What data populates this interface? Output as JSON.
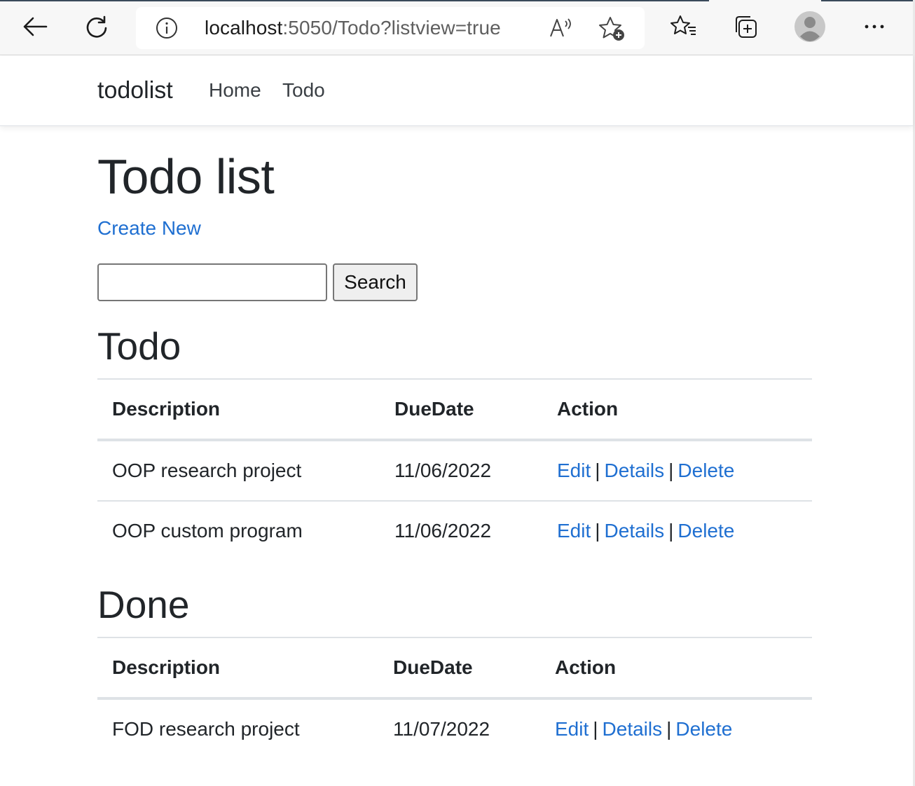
{
  "browser": {
    "url_host": "localhost",
    "url_rest": ":5050/Todo?listview=true"
  },
  "nav": {
    "brand": "todolist",
    "links": [
      "Home",
      "Todo"
    ]
  },
  "page": {
    "title": "Todo list",
    "create_label": "Create New",
    "search_value": "",
    "search_button": "Search"
  },
  "sections": [
    {
      "heading": "Todo",
      "columns": [
        "Description",
        "DueDate",
        "Action"
      ],
      "rows": [
        {
          "description": "OOP research project",
          "due": "11/06/2022"
        },
        {
          "description": "OOP custom program",
          "due": "11/06/2022"
        }
      ]
    },
    {
      "heading": "Done",
      "columns": [
        "Description",
        "DueDate",
        "Action"
      ],
      "rows": [
        {
          "description": "FOD research project",
          "due": "11/07/2022"
        }
      ]
    }
  ],
  "actions": {
    "edit": "Edit",
    "details": "Details",
    "delete": "Delete",
    "separator": "|"
  },
  "colors": {
    "link": "#1f6fd1",
    "text": "#212529"
  }
}
